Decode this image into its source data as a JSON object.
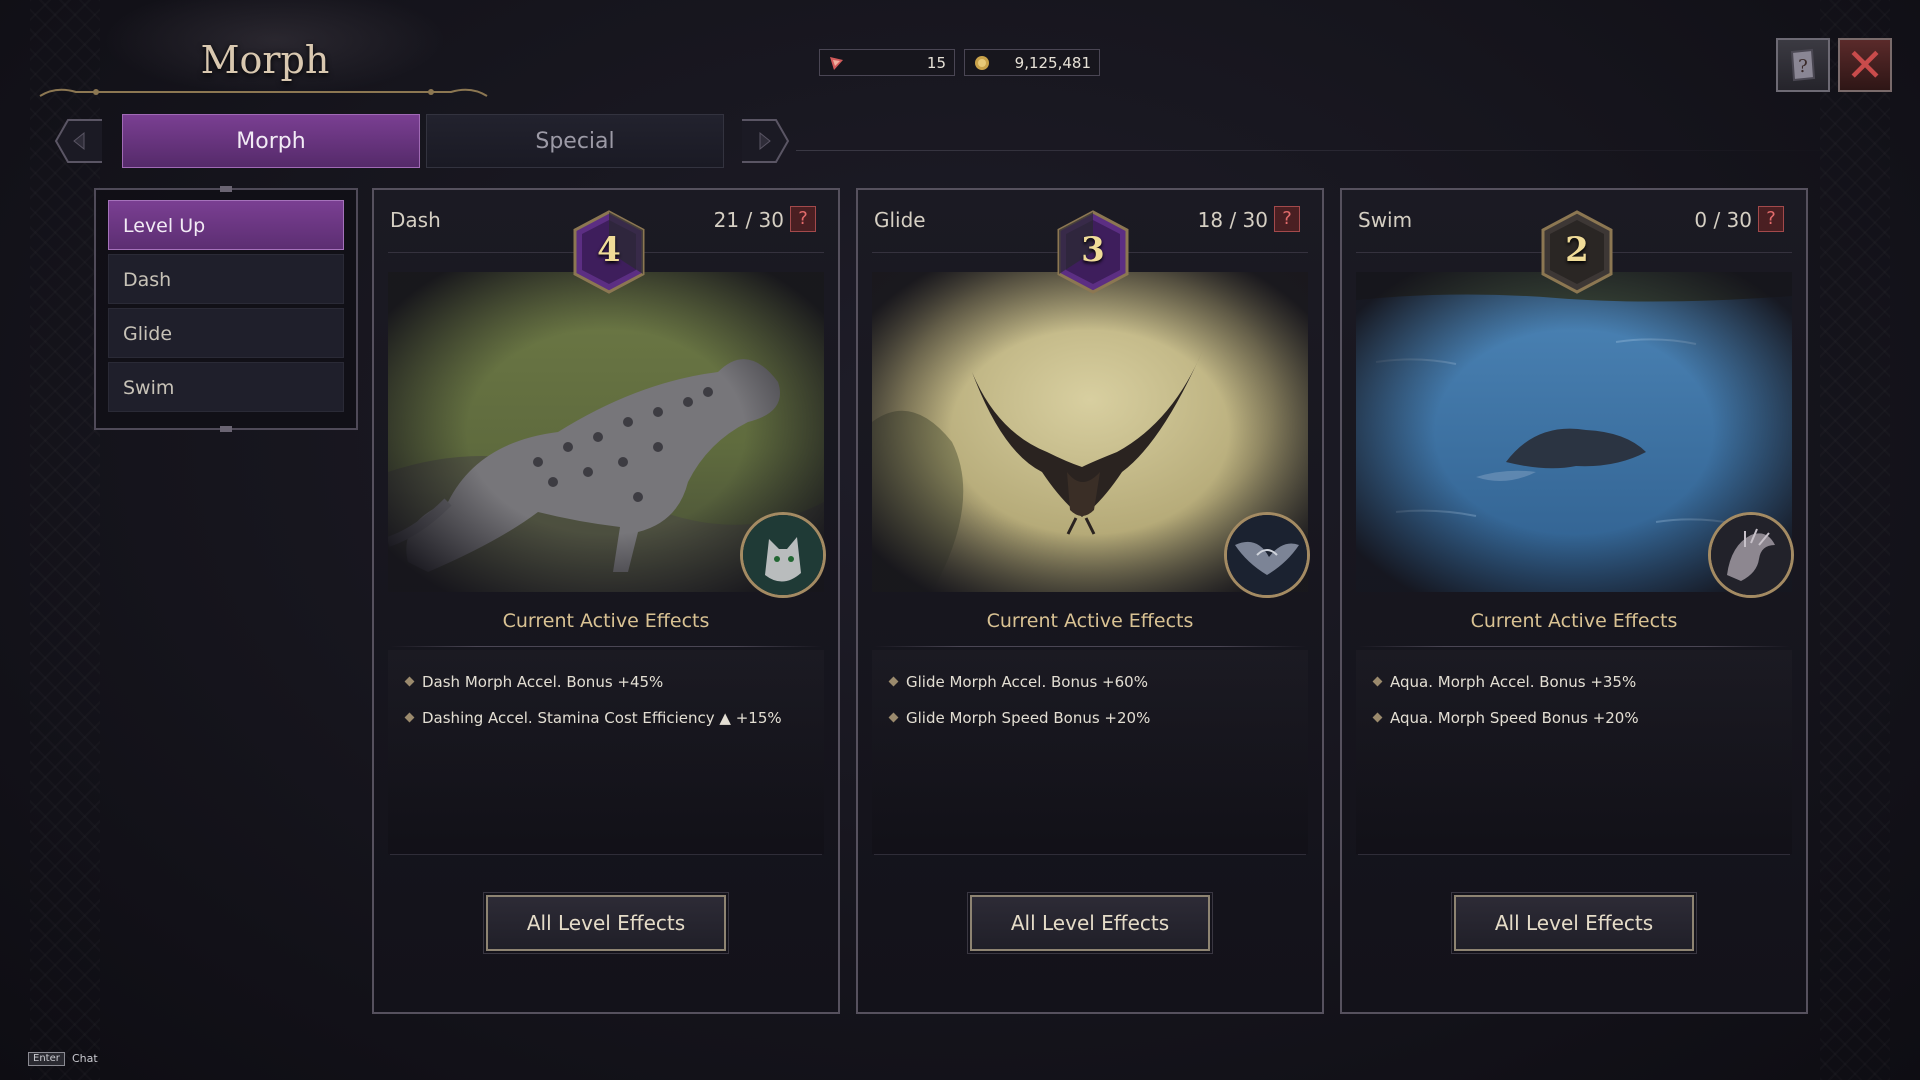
{
  "header": {
    "title": "Morph",
    "currency": [
      {
        "icon": "token-icon",
        "value": "15"
      },
      {
        "icon": "gold-coin-icon",
        "value": "9,125,481"
      }
    ],
    "help_icon": "help-book-icon",
    "close_icon": "close-icon",
    "close_glyph": "✕"
  },
  "tabs": [
    {
      "label": "Morph",
      "active": true
    },
    {
      "label": "Special",
      "active": false
    }
  ],
  "menu": {
    "items": [
      {
        "label": "Level Up",
        "active": true
      },
      {
        "label": "Dash",
        "active": false
      },
      {
        "label": "Glide",
        "active": false
      },
      {
        "label": "Swim",
        "active": false
      }
    ]
  },
  "cards": [
    {
      "name": "Dash",
      "level": "4",
      "progress": "21 / 30",
      "help": "?",
      "effects_title": "Current Active Effects",
      "effects": [
        "Dash Morph Accel. Bonus +45%",
        "Dashing Accel. Stamina Cost Efficiency ▲ +15%"
      ],
      "button": "All Level Effects",
      "skill_icon": "wolf-skill-icon"
    },
    {
      "name": "Glide",
      "level": "3",
      "progress": "18 / 30",
      "help": "?",
      "effects_title": "Current Active Effects",
      "effects": [
        "Glide Morph Accel. Bonus +60%",
        "Glide Morph Speed Bonus  +20%"
      ],
      "button": "All Level Effects",
      "skill_icon": "eagle-skill-icon"
    },
    {
      "name": "Swim",
      "level": "2",
      "progress": "0 / 30",
      "help": "?",
      "effects_title": "Current Active Effects",
      "effects": [
        "Aqua. Morph Accel. Bonus +35%",
        "Aqua. Morph Speed Bonus +20%"
      ],
      "button": "All Level Effects",
      "skill_icon": "dragon-skill-icon"
    }
  ],
  "footer": {
    "key": "Enter",
    "label": "Chat"
  },
  "colors": {
    "accent_purple": "#7a3f92",
    "gold": "#d9c293",
    "danger": "#c94b4b"
  }
}
